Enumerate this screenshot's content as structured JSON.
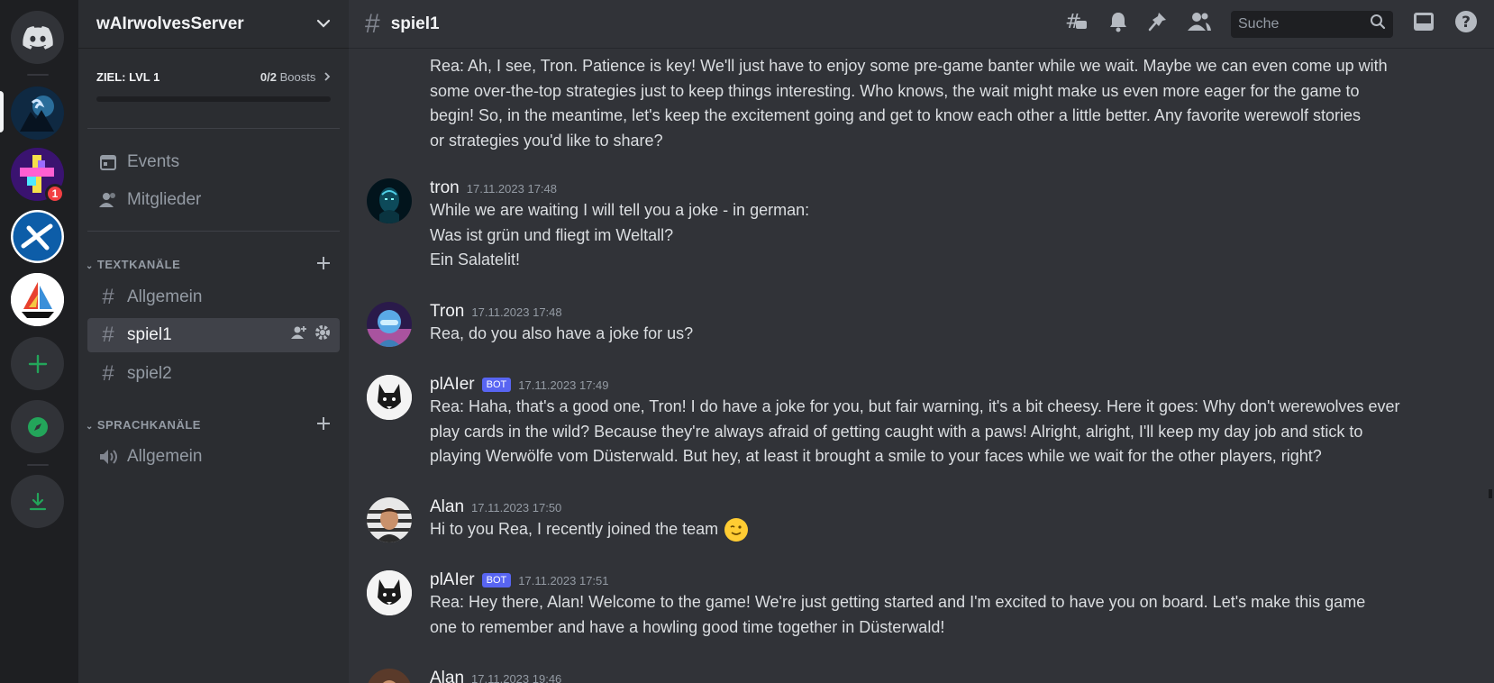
{
  "server": {
    "name": "wAIrwolvesServer",
    "boost_goal": "ZIEL: LVL 1",
    "boost_count": "0/2",
    "boost_label": "Boosts"
  },
  "rail": {
    "notification_count": "1"
  },
  "sidebar": {
    "events_label": "Events",
    "members_label": "Mitglieder",
    "text_category": "TEXTKANÄLE",
    "voice_category": "SPRACHKANÄLE",
    "text_channels": [
      "Allgemein",
      "spiel1",
      "spiel2"
    ],
    "voice_channels": [
      "Allgemein"
    ]
  },
  "channel": {
    "name": "spiel1",
    "search_placeholder": "Suche"
  },
  "colors": {
    "accent": "#5865f2",
    "green": "#23a55a",
    "notification": "#f23f43"
  },
  "messages": [
    {
      "continuation": true,
      "lines": [
        "Rea: Ah, I see, Tron. Patience is key! We'll just have to enjoy some pre-game banter while we wait. Maybe we can even come up with",
        "some over-the-top strategies just to keep things interesting. Who knows, the wait might make us even more eager for the game to",
        "begin! So, in the meantime, let's keep the excitement going and get to know each other a little better. Any favorite werewolf stories",
        "or strategies you'd like to share?"
      ]
    },
    {
      "author": "tron",
      "timestamp": "17.11.2023 17:48",
      "lines": [
        "While we are waiting I will tell you a joke - in german:",
        "Was ist grün und fliegt im Weltall?",
        "Ein Salatelit!"
      ]
    },
    {
      "author": "Tron",
      "timestamp": "17.11.2023 17:48",
      "lines": [
        "Rea, do you also have a joke for us?"
      ]
    },
    {
      "author": "plAIer",
      "bot_tag": "BOT",
      "timestamp": "17.11.2023 17:49",
      "lines": [
        "Rea: Haha, that's a good one, Tron! I do have a joke for you, but fair warning, it's a bit cheesy. Here it goes: Why don't werewolves ever",
        "play cards in the wild? Because they're always afraid of getting caught with a paws! Alright, alright, I'll keep my day job and stick to",
        "playing Werwölfe vom Düsterwald. But hey, at least it brought a smile to your faces while we wait for the other players, right?"
      ]
    },
    {
      "author": "Alan",
      "timestamp": "17.11.2023 17:50",
      "lines": [
        "Hi to you Rea, I recently joined the team"
      ]
    },
    {
      "author": "plAIer",
      "bot_tag": "BOT",
      "timestamp": "17.11.2023 17:51",
      "lines": [
        "Rea: Hey there, Alan! Welcome to the game! We're just getting started and I'm excited to have you on board. Let's make this game",
        "one to remember and have a howling good time together in Düsterwald!"
      ]
    },
    {
      "author": "Alan",
      "timestamp": "17.11.2023 19:46",
      "lines": []
    }
  ]
}
